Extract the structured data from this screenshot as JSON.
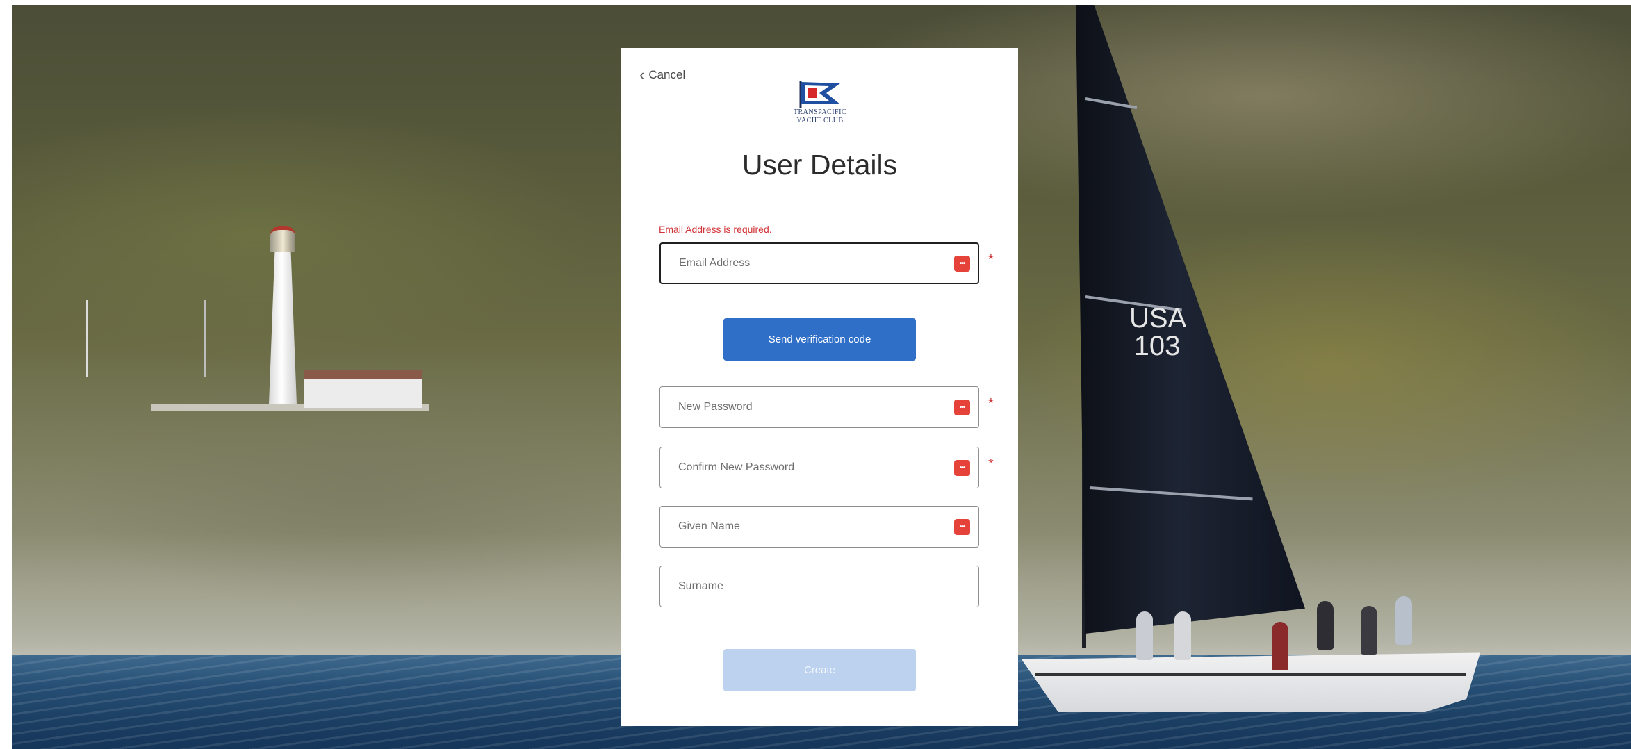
{
  "cancel_label": "Cancel",
  "logo": {
    "line1": "Transpacific",
    "line2": "Yacht Club"
  },
  "page_title": "User Details",
  "error": "Email Address is required.",
  "fields": {
    "email": {
      "placeholder": "Email Address",
      "required": true,
      "invalid": true
    },
    "new_password": {
      "placeholder": "New Password",
      "required": true
    },
    "confirm_password": {
      "placeholder": "Confirm New Password",
      "required": true
    },
    "given_name": {
      "placeholder": "Given Name",
      "required": false
    },
    "surname": {
      "placeholder": "Surname",
      "required": false
    }
  },
  "required_marker": "*",
  "send_code_label": "Send verification code",
  "create_label": "Create",
  "sail_number": {
    "line1": "USA",
    "line2": "103"
  },
  "colors": {
    "primary": "#2f6fc7",
    "primary_disabled": "#bcd2ee",
    "error": "#d13438",
    "password_manager_icon": "#e5423a"
  },
  "icons": {
    "back": "chevron-left-icon",
    "password_manager": "password-manager-icon"
  }
}
